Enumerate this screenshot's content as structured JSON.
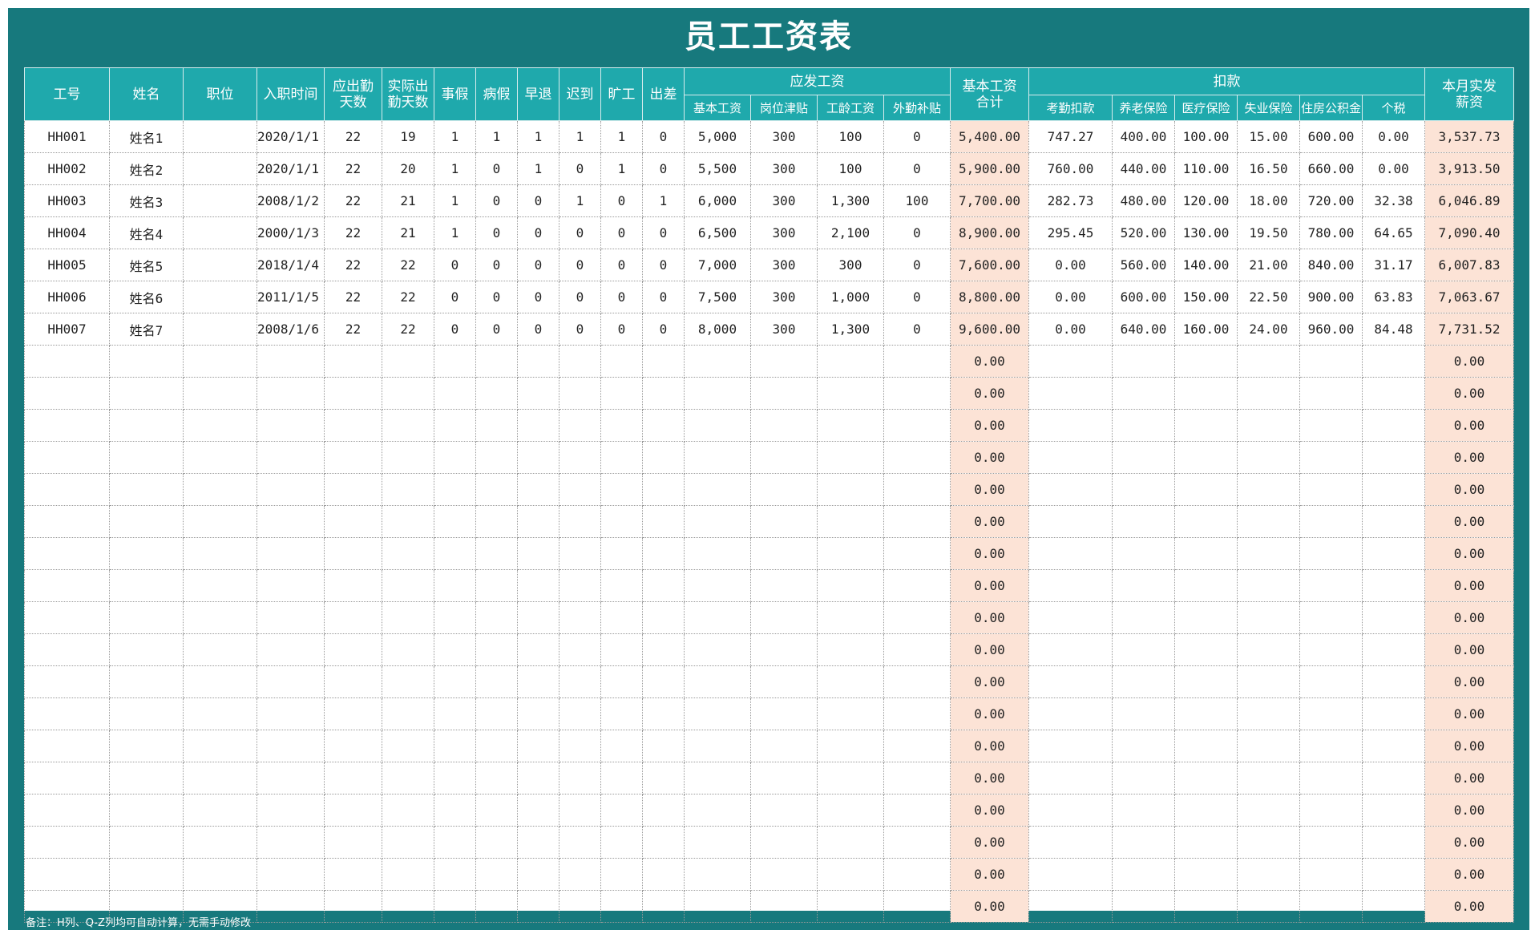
{
  "title": "员工工资表",
  "headers": {
    "emp_id": "工号",
    "name": "姓名",
    "position": "职位",
    "hire_date": "入职时间",
    "due_days": "应出勤\n天数",
    "actual_days": "实际出\n勤天数",
    "personal_leave": "事假",
    "sick_leave": "病假",
    "early_leave": "早退",
    "late": "迟到",
    "absent": "旷工",
    "business_trip": "出差",
    "payable_group": "应发工资",
    "base_salary": "基本工资",
    "post_allowance": "岗位津贴",
    "seniority_pay": "工龄工资",
    "other_allowance": "外勤补贴",
    "base_total": "基本工资\n合计",
    "deduction_group": "扣款",
    "attendance_deduction": "考勤扣款",
    "pension": "养老保险",
    "medical": "医疗保险",
    "unemployment": "失业保险",
    "housing_fund": "住房公积金",
    "income_tax": "个税",
    "net_pay": "本月实发\n薪资"
  },
  "rows": [
    {
      "id": "HH001",
      "name": "姓名1",
      "position": "",
      "hire": "2020/1/1",
      "due": "22",
      "actual": "19",
      "personal": "1",
      "sick": "1",
      "early": "1",
      "late": "1",
      "absent": "1",
      "trip": "0",
      "base": "5,000",
      "post": "300",
      "seniority": "100",
      "other": "0",
      "total": "5,400.00",
      "attend": "747.27",
      "pension": "400.00",
      "medical": "100.00",
      "unemp": "15.00",
      "housing": "600.00",
      "tax": "0.00",
      "net": "3,537.73"
    },
    {
      "id": "HH002",
      "name": "姓名2",
      "position": "",
      "hire": "2020/1/1",
      "due": "22",
      "actual": "20",
      "personal": "1",
      "sick": "0",
      "early": "1",
      "late": "0",
      "absent": "1",
      "trip": "0",
      "base": "5,500",
      "post": "300",
      "seniority": "100",
      "other": "0",
      "total": "5,900.00",
      "attend": "760.00",
      "pension": "440.00",
      "medical": "110.00",
      "unemp": "16.50",
      "housing": "660.00",
      "tax": "0.00",
      "net": "3,913.50"
    },
    {
      "id": "HH003",
      "name": "姓名3",
      "position": "",
      "hire": "2008/1/2",
      "due": "22",
      "actual": "21",
      "personal": "1",
      "sick": "0",
      "early": "0",
      "late": "1",
      "absent": "0",
      "trip": "1",
      "base": "6,000",
      "post": "300",
      "seniority": "1,300",
      "other": "100",
      "total": "7,700.00",
      "attend": "282.73",
      "pension": "480.00",
      "medical": "120.00",
      "unemp": "18.00",
      "housing": "720.00",
      "tax": "32.38",
      "net": "6,046.89"
    },
    {
      "id": "HH004",
      "name": "姓名4",
      "position": "",
      "hire": "2000/1/3",
      "due": "22",
      "actual": "21",
      "personal": "1",
      "sick": "0",
      "early": "0",
      "late": "0",
      "absent": "0",
      "trip": "0",
      "base": "6,500",
      "post": "300",
      "seniority": "2,100",
      "other": "0",
      "total": "8,900.00",
      "attend": "295.45",
      "pension": "520.00",
      "medical": "130.00",
      "unemp": "19.50",
      "housing": "780.00",
      "tax": "64.65",
      "net": "7,090.40"
    },
    {
      "id": "HH005",
      "name": "姓名5",
      "position": "",
      "hire": "2018/1/4",
      "due": "22",
      "actual": "22",
      "personal": "0",
      "sick": "0",
      "early": "0",
      "late": "0",
      "absent": "0",
      "trip": "0",
      "base": "7,000",
      "post": "300",
      "seniority": "300",
      "other": "0",
      "total": "7,600.00",
      "attend": "0.00",
      "pension": "560.00",
      "medical": "140.00",
      "unemp": "21.00",
      "housing": "840.00",
      "tax": "31.17",
      "net": "6,007.83"
    },
    {
      "id": "HH006",
      "name": "姓名6",
      "position": "",
      "hire": "2011/1/5",
      "due": "22",
      "actual": "22",
      "personal": "0",
      "sick": "0",
      "early": "0",
      "late": "0",
      "absent": "0",
      "trip": "0",
      "base": "7,500",
      "post": "300",
      "seniority": "1,000",
      "other": "0",
      "total": "8,800.00",
      "attend": "0.00",
      "pension": "600.00",
      "medical": "150.00",
      "unemp": "22.50",
      "housing": "900.00",
      "tax": "63.83",
      "net": "7,063.67"
    },
    {
      "id": "HH007",
      "name": "姓名7",
      "position": "",
      "hire": "2008/1/6",
      "due": "22",
      "actual": "22",
      "personal": "0",
      "sick": "0",
      "early": "0",
      "late": "0",
      "absent": "0",
      "trip": "0",
      "base": "8,000",
      "post": "300",
      "seniority": "1,300",
      "other": "0",
      "total": "9,600.00",
      "attend": "0.00",
      "pension": "640.00",
      "medical": "160.00",
      "unemp": "24.00",
      "housing": "960.00",
      "tax": "84.48",
      "net": "7,731.52"
    },
    {
      "total": "0.00",
      "net": "0.00"
    },
    {
      "total": "0.00",
      "net": "0.00"
    },
    {
      "total": "0.00",
      "net": "0.00"
    },
    {
      "total": "0.00",
      "net": "0.00"
    },
    {
      "total": "0.00",
      "net": "0.00"
    },
    {
      "total": "0.00",
      "net": "0.00"
    },
    {
      "total": "0.00",
      "net": "0.00"
    },
    {
      "total": "0.00",
      "net": "0.00"
    },
    {
      "total": "0.00",
      "net": "0.00"
    },
    {
      "total": "0.00",
      "net": "0.00"
    },
    {
      "total": "0.00",
      "net": "0.00"
    },
    {
      "total": "0.00",
      "net": "0.00"
    },
    {
      "total": "0.00",
      "net": "0.00"
    },
    {
      "total": "0.00",
      "net": "0.00"
    },
    {
      "total": "0.00",
      "net": "0.00"
    },
    {
      "total": "0.00",
      "net": "0.00"
    },
    {
      "total": "0.00",
      "net": "0.00"
    },
    {
      "total": "0.00",
      "net": "0.00"
    }
  ],
  "note": "备注：H列、Q-Z列均可自动计算，无需手动修改",
  "colors": {
    "frame": "#17797d",
    "header": "#1fa9ac",
    "highlight": "#fce3d6"
  }
}
